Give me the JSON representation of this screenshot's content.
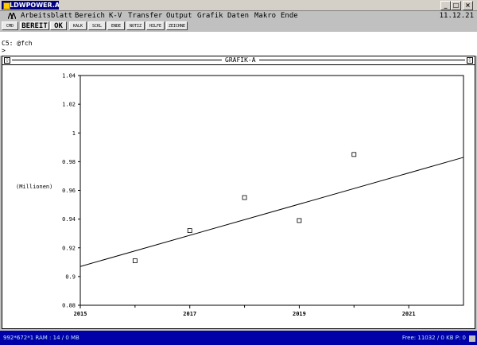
{
  "window": {
    "title": "LDWPOWER.ABC",
    "icon": "app-icon",
    "buttons": [
      "_",
      "□",
      "×"
    ]
  },
  "menu": {
    "items": [
      "Arbeitsblatt",
      "Bereich",
      "K-V",
      "Transfer",
      "Output",
      "Grafik",
      "Daten",
      "Makro",
      "Ende"
    ],
    "date": "11.12.21"
  },
  "toolbar": {
    "buttons": [
      "CMD",
      "BEREIT",
      "OK",
      "KALK",
      "SCKL",
      "ENDE",
      "NOTIZ",
      "HILFE",
      "ZEICHNE"
    ]
  },
  "cell": {
    "ref": "C5:",
    "value": "@fch",
    "prompt": ">"
  },
  "graph_window": {
    "title": "GRAFIK-A",
    "left_box": "◊",
    "right_box": "◊"
  },
  "chart_data": {
    "type": "scatter",
    "title": "",
    "xlabel": "",
    "ylabel": "(Millionen)",
    "xlim": [
      2015,
      2022
    ],
    "ylim": [
      0.88,
      1.04
    ],
    "x_ticks": [
      2015,
      2017,
      2019,
      2021
    ],
    "x_minor_ticks": [
      2016,
      2018,
      2020
    ],
    "y_ticks": [
      0.88,
      0.9,
      0.92,
      0.94,
      0.96,
      0.98,
      1.0,
      1.02,
      1.04
    ],
    "y_tick_labels": [
      "0.88",
      "0.9",
      "0.92",
      "0.94",
      "0.96",
      "0.98",
      "1",
      "1.02",
      "1.04"
    ],
    "grid": false,
    "series": [
      {
        "type": "scatter",
        "marker": "square",
        "x": [
          2016,
          2017,
          2018,
          2019,
          2020
        ],
        "y": [
          0.911,
          0.932,
          0.955,
          0.939,
          0.985
        ]
      },
      {
        "type": "line",
        "x": [
          2015,
          2022
        ],
        "y": [
          0.907,
          0.983
        ]
      }
    ]
  },
  "status": {
    "left": "992*672*1   RAM : 14 / 0 MB",
    "right": "Free: 11032 / 0 KB  P: 0"
  },
  "colors": {
    "title_bar": "#000080",
    "status_bar": "#0000a8",
    "window_bg": "#c0c0c0",
    "plot_bg": "#ffffff"
  }
}
